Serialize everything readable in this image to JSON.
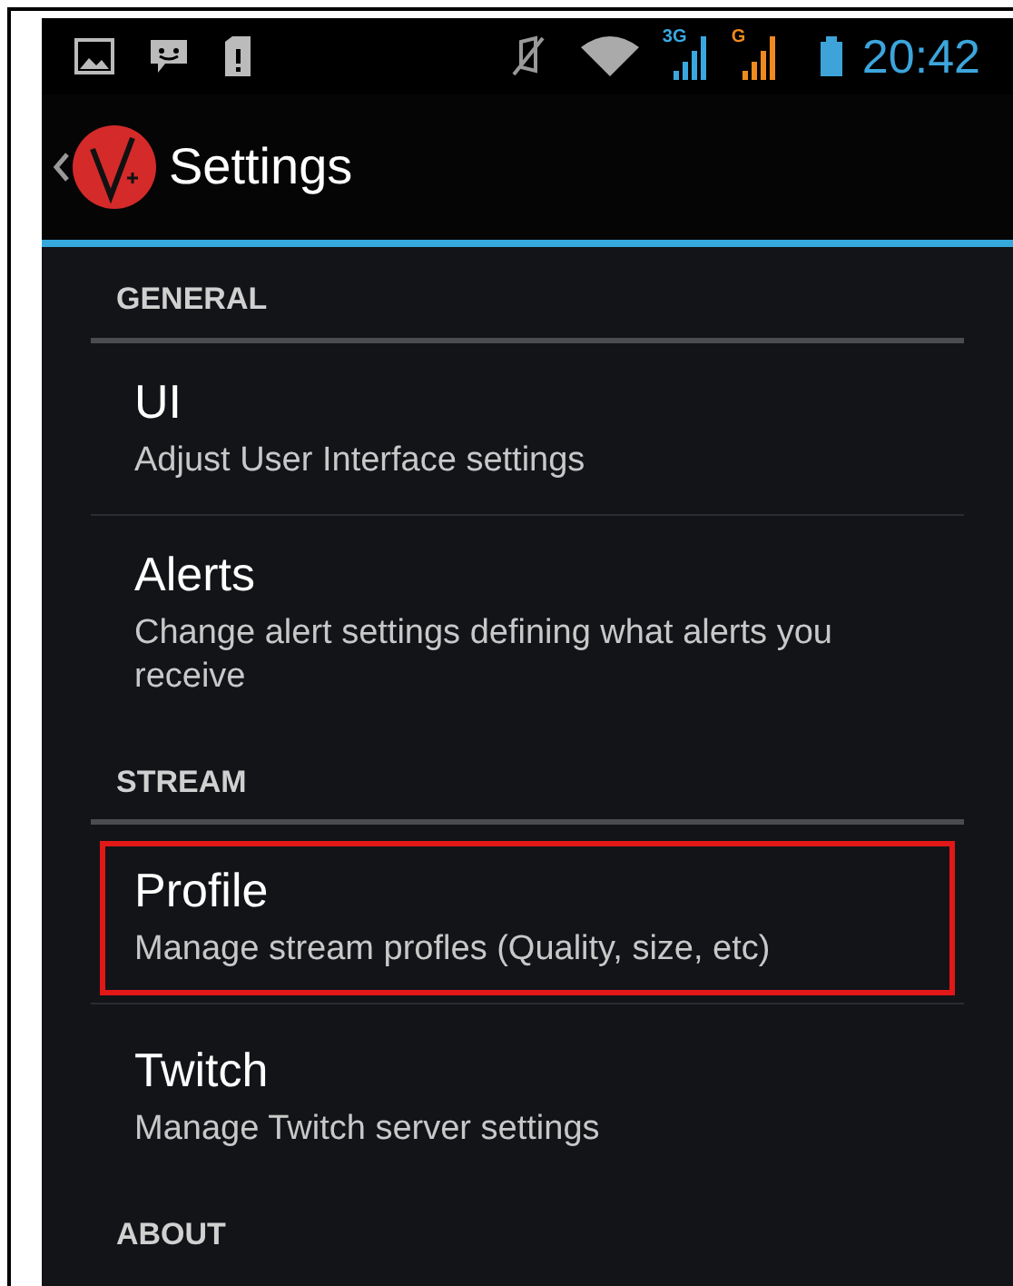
{
  "status_bar": {
    "network_labels": [
      "3G",
      "G"
    ],
    "time": "20:42"
  },
  "action_bar": {
    "title": "Settings"
  },
  "sections": [
    {
      "header": "GENERAL",
      "items": [
        {
          "title": "UI",
          "summary": "Adjust User Interface settings",
          "highlighted": false
        },
        {
          "title": "Alerts",
          "summary": "Change alert settings defining what alerts you receive",
          "highlighted": false
        }
      ]
    },
    {
      "header": "STREAM",
      "items": [
        {
          "title": "Profile",
          "summary": "Manage stream profles (Quality, size, etc)",
          "highlighted": true
        },
        {
          "title": "Twitch",
          "summary": "Manage Twitch server settings",
          "highlighted": false
        }
      ]
    },
    {
      "header": "ABOUT"
    }
  ]
}
